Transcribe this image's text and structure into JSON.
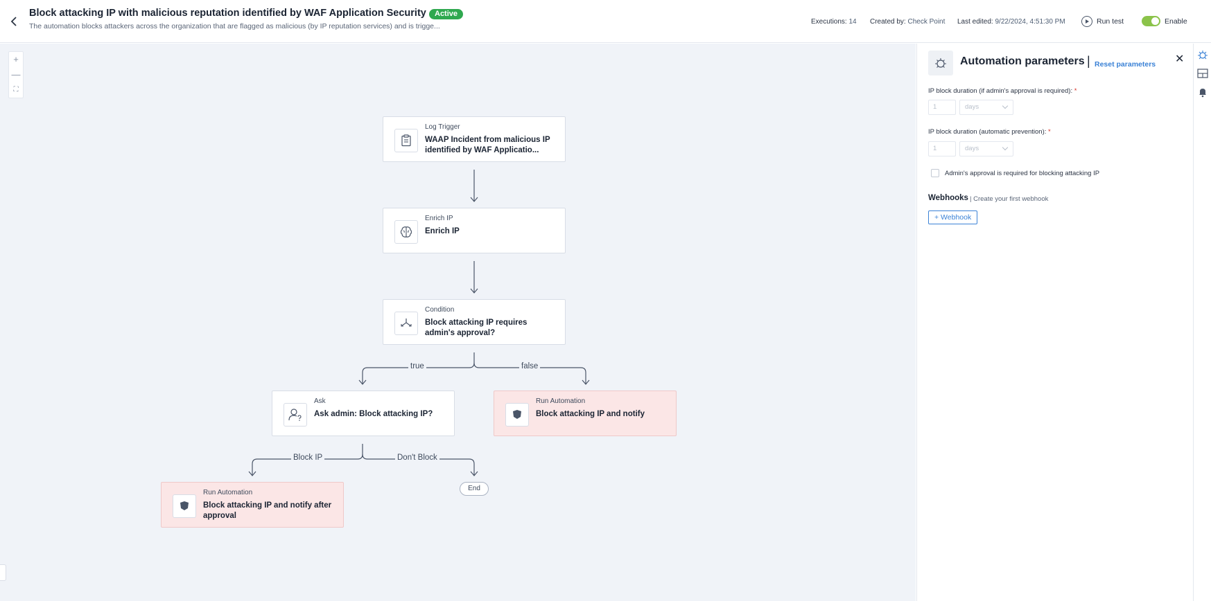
{
  "header": {
    "title": "Block attacking IP with malicious reputation identified by WAF Application Security",
    "status_badge": "Active",
    "subtitle": "The automation blocks attackers across the organization that are flagged as malicious (by IP reputation services) and is trigge...",
    "executions_label": "Executions:",
    "executions_value": "14",
    "created_by_label": "Created by:",
    "created_by_value": "Check Point",
    "last_edited_label": "Last edited:",
    "last_edited_value": "9/22/2024, 4:51:30 PM",
    "run_test_label": "Run test",
    "enable_label": "Enable"
  },
  "zoom": {
    "plus": "+",
    "minus": "—",
    "fit": "⛶"
  },
  "nodes": [
    {
      "type": "Log Trigger",
      "label": "WAAP Incident from malicious IP identified by WAF Applicatio...",
      "icon": "clipboard-icon"
    },
    {
      "type": "Enrich IP",
      "label": "Enrich IP",
      "icon": "brain-icon"
    },
    {
      "type": "Condition",
      "label": "Block attacking IP requires admin's approval?",
      "icon": "branch-icon"
    },
    {
      "type": "Ask",
      "label": "Ask admin: Block attacking IP?",
      "icon": "user-question-icon"
    },
    {
      "type": "Run Automation",
      "label": "Block attacking IP and notify",
      "icon": "shield-icon"
    },
    {
      "type": "Run Automation",
      "label": "Block attacking IP and notify after approval",
      "icon": "shield-icon"
    }
  ],
  "end_node": "End",
  "edges": {
    "true_label": "true",
    "false_label": "false",
    "block_ip_label": "Block IP",
    "dont_block_label": "Don't Block"
  },
  "panel": {
    "title": "Automation parameters",
    "separator": "|",
    "reset_link": "Reset parameters",
    "close": "✕",
    "field1_label": "IP block duration (if admin's approval is required):",
    "field1_value": "1",
    "field1_unit": "days",
    "field2_label": "IP block duration (automatic prevention):",
    "field2_value": "1",
    "field2_unit": "days",
    "required_mark": "*",
    "checkbox_label": "Admin's approval is required for blocking attacking IP",
    "checkbox_checked": false,
    "webhooks_title": "Webhooks",
    "webhooks_link": "| Create your first webhook",
    "webhook_button": "+ Webhook"
  },
  "colors": {
    "active_badge": "#2fa84f",
    "accent": "#3b82d6",
    "canvas_bg": "#f0f3f8",
    "run_automation_bg": "#fbe6e6",
    "toggle_on": "#8bc34a"
  }
}
